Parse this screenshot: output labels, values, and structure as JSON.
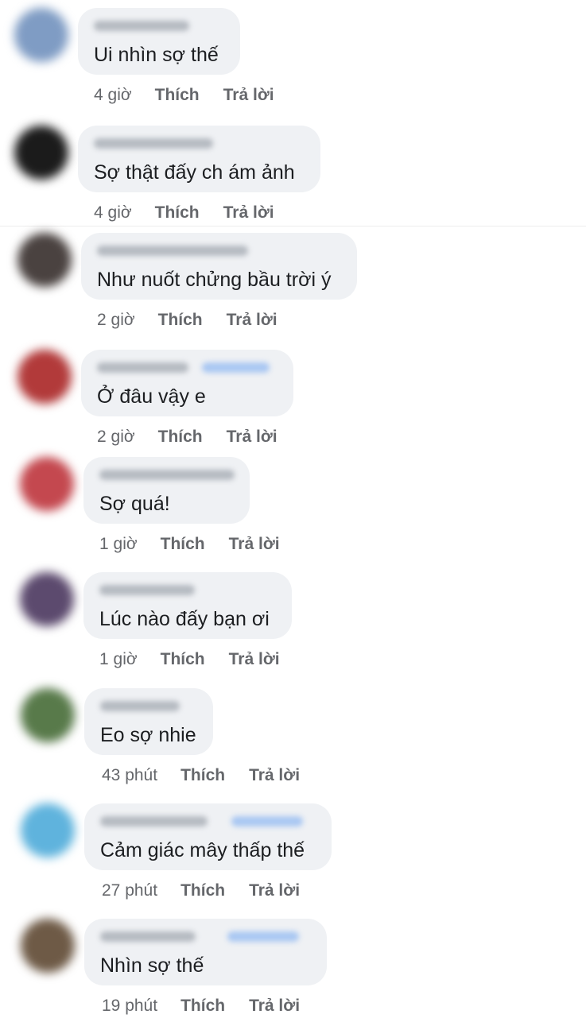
{
  "actions": {
    "like": "Thích",
    "reply": "Trả lời"
  },
  "comments": [
    {
      "text": "Ui nhìn sợ thế",
      "time": "4 giờ",
      "avatar_color": "#7f9cc4"
    },
    {
      "text": "Sợ thật đấy ch ám ảnh",
      "time": "4 giờ",
      "avatar_color": "#1b1b1b"
    },
    {
      "text": "Như nuốt chửng bầu trời ý",
      "time": "2 giờ",
      "avatar_color": "#4a4240"
    },
    {
      "text": "Ở đâu vậy e",
      "time": "2 giờ",
      "avatar_color": "#b23a3a"
    },
    {
      "text": "Sợ quá!",
      "time": "1 giờ",
      "avatar_color": "#c4484f"
    },
    {
      "text": "Lúc nào đấy bạn ơi",
      "time": "1 giờ",
      "avatar_color": "#5c4a6e"
    },
    {
      "text": "Eo sợ nhie",
      "time": "43 phút",
      "avatar_color": "#587a4a"
    },
    {
      "text": "Cảm giác mây thấp thế",
      "time": "27 phút",
      "avatar_color": "#5fb3dd"
    },
    {
      "text": "Nhìn sợ thế",
      "time": "19 phút",
      "avatar_color": "#6e5a46"
    }
  ]
}
